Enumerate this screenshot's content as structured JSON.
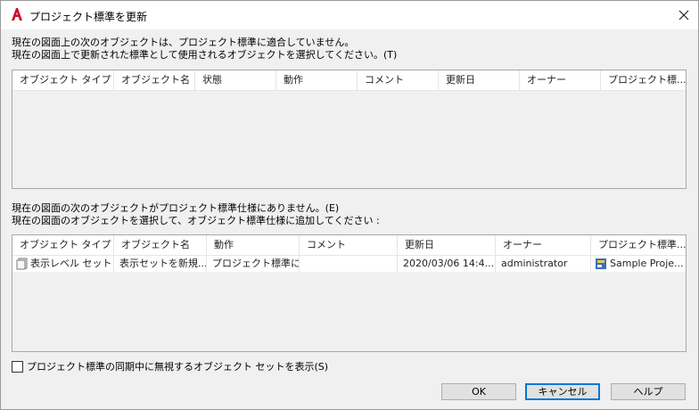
{
  "window": {
    "title": "プロジェクト標準を更新"
  },
  "top_section": {
    "line1": "現在の図面上の次のオブジェクトは、プロジェクト標準に適合していません。",
    "line2": "現在の図面上で更新された標準として使用されるオブジェクトを選択してください。(T)",
    "columns": [
      "オブジェクト タイプ",
      "オブジェクト名",
      "状態",
      "動作",
      "コメント",
      "更新日",
      "オーナー",
      "プロジェクト標..."
    ],
    "rows": []
  },
  "bottom_section": {
    "line1": "現在の図面の次のオブジェクトがプロジェクト標準仕様にありません。(E)",
    "line2": "現在の図面のオブジェクトを選択して、オブジェクト標準仕様に追加してください :",
    "columns": [
      "オブジェクト タイプ",
      "オブジェクト名",
      "動作",
      "コメント",
      "更新日",
      "オーナー",
      "プロジェクト標準..."
    ],
    "rows": [
      {
        "type": "表示レベル セット",
        "name": "表示セットを新規...",
        "action": "プロジェクト標準に...",
        "comment": "",
        "updated": "2020/03/06 14:4...",
        "owner": "administrator",
        "project": "Sample Proje..."
      }
    ]
  },
  "checkbox": {
    "label": "プロジェクト標準の同期中に無視するオブジェクト セットを表示(S)",
    "checked": false
  },
  "buttons": {
    "ok": "OK",
    "cancel": "キャンセル",
    "help": "ヘルプ"
  },
  "colors": {
    "accent": "#0078d7",
    "app_icon": "#c8102e"
  }
}
